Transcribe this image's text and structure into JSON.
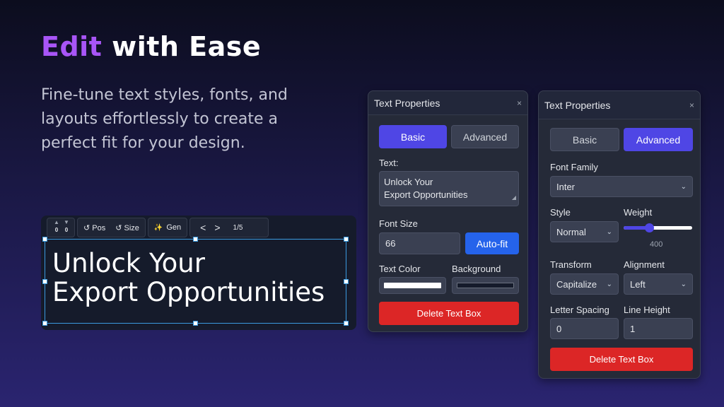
{
  "headline": {
    "accent": "Edit",
    "rest": "with Ease"
  },
  "subtitle": [
    "Fine-tune text styles, fonts, and",
    "layouts effortlessly to create a",
    "perfect fit for your design."
  ],
  "editor": {
    "stepper": {
      "up": "▲",
      "down": "▼",
      "x": "0",
      "y": "0"
    },
    "pos_label": "↺ Pos",
    "size_label": "↺ Size",
    "gen_icon": "✨",
    "gen_label": "Gen",
    "prev": "<",
    "next": ">",
    "page": "1/5",
    "text_lines": [
      "Unlock Your",
      "Export Opportunities"
    ]
  },
  "panel_basic": {
    "title": "Text Properties",
    "close": "×",
    "tab_basic": "Basic",
    "tab_advanced": "Advanced",
    "active_tab": "Basic",
    "text_label": "Text:",
    "text_value": [
      "Unlock Your",
      "Export Opportunities"
    ],
    "font_size_label": "Font Size",
    "font_size_value": "66",
    "autofit_label": "Auto-fit",
    "text_color_label": "Text Color",
    "text_color": "#ffffff",
    "background_label": "Background",
    "background_color": "#151b2b",
    "delete_label": "Delete Text Box"
  },
  "panel_advanced": {
    "title": "Text Properties",
    "close": "×",
    "tab_basic": "Basic",
    "tab_advanced": "Advanced",
    "active_tab": "Advanced",
    "font_family_label": "Font Family",
    "font_family_value": "Inter",
    "style_label": "Style",
    "style_value": "Normal",
    "weight_label": "Weight",
    "weight_value": "400",
    "weight_fraction": 0.37,
    "transform_label": "Transform",
    "transform_value": "Capitalize",
    "alignment_label": "Alignment",
    "alignment_value": "Left",
    "letter_spacing_label": "Letter Spacing",
    "letter_spacing_value": "0",
    "line_height_label": "Line Height",
    "line_height_value": "1",
    "delete_label": "Delete Text Box"
  },
  "colors": {
    "accent_purple": "#a855f7",
    "tab_active": "#4f46e5",
    "autofit_blue": "#2563eb",
    "delete_red": "#dc2626"
  }
}
